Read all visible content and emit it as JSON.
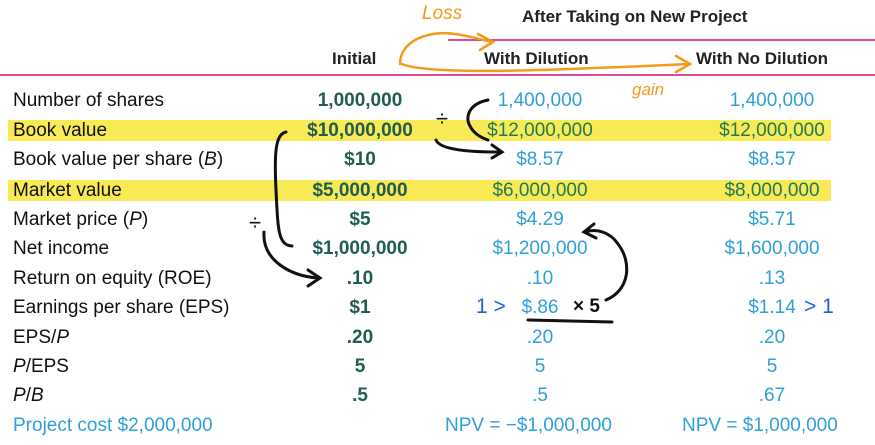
{
  "header": {
    "group_title": "After Taking on New Project",
    "col_initial": "Initial",
    "col_with_dilution": "With Dilution",
    "col_no_dilution": "With No Dilution"
  },
  "rows": [
    {
      "label": "Number of shares",
      "initial": "1,000,000",
      "with_dilution": "1,400,000",
      "no_dilution": "1,400,000"
    },
    {
      "label": "Book value",
      "initial": "$10,000,000",
      "with_dilution": "$12,000,000",
      "no_dilution": "$12,000,000"
    },
    {
      "label": "Book value per share (B)",
      "initial": "$10",
      "with_dilution": "$8.57",
      "no_dilution": "$8.57"
    },
    {
      "label": "Market value",
      "initial": "$5,000,000",
      "with_dilution": "$6,000,000",
      "no_dilution": "$8,000,000"
    },
    {
      "label": "Market price (P)",
      "initial": "$5",
      "with_dilution": "$4.29",
      "no_dilution": "$5.71"
    },
    {
      "label": "Net income",
      "initial": "$1,000,000",
      "with_dilution": "$1,200,000",
      "no_dilution": "$1,600,000"
    },
    {
      "label": "Return on equity (ROE)",
      "initial": ".10",
      "with_dilution": ".10",
      "no_dilution": ".13"
    },
    {
      "label": "Earnings per share (EPS)",
      "initial": "$1",
      "with_dilution": "$.86",
      "no_dilution": "$1.14"
    },
    {
      "label": "EPS/P",
      "initial": ".20",
      "with_dilution": ".20",
      "no_dilution": ".20"
    },
    {
      "label": "P/EPS",
      "initial": "5",
      "with_dilution": "5",
      "no_dilution": "5"
    },
    {
      "label": "P/B",
      "initial": ".5",
      "with_dilution": ".5",
      "no_dilution": ".67"
    }
  ],
  "footer": {
    "project_cost": "Project cost $2,000,000",
    "npv_dilution": "NPV = −$1,000,000",
    "npv_no_dilution": "NPV = $1,000,000"
  },
  "annotations": {
    "loss": "Loss",
    "gain": "gain",
    "divide_1": "÷",
    "divide_2": "÷",
    "compare_left": "1 >",
    "compare_right": "> 1",
    "times_five": "× 5"
  },
  "colors": {
    "rule": "#e0489a",
    "highlight": "#f7ea55",
    "initial_text": "#1f5c52",
    "new_text": "#2ea0d8",
    "ink_orange": "#f29a1c",
    "ink_blue": "#1e63d6"
  }
}
